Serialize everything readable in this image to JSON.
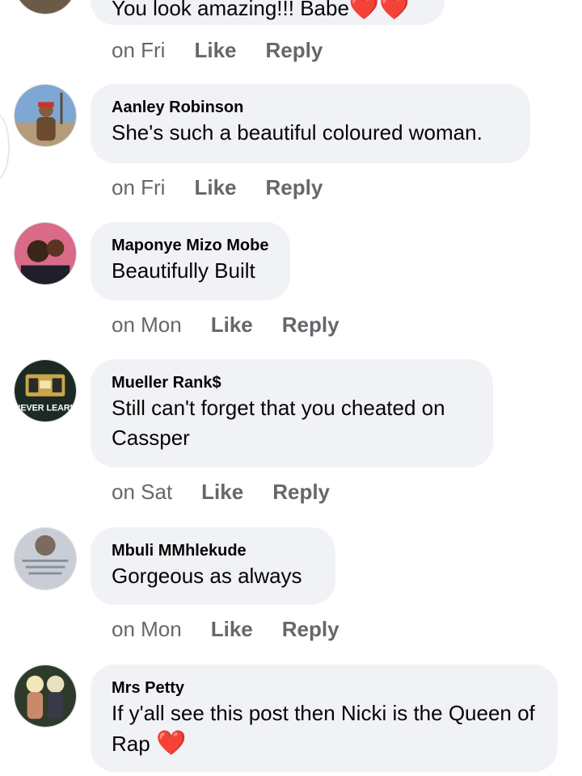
{
  "top": {
    "text": "You look amazing!!! Babe",
    "hearts": "❤️❤️",
    "time": "on Fri",
    "like": "Like",
    "reply": "Reply"
  },
  "comments": [
    {
      "name": "Aanley Robinson",
      "text": "She's such a beautiful coloured woman.",
      "time": "on Fri",
      "like": "Like",
      "reply": "Reply"
    },
    {
      "name": "Maponye Mizo Mobe",
      "text": "Beautifully Built",
      "time": "on Mon",
      "like": "Like",
      "reply": "Reply"
    },
    {
      "name": "Mueller Rank$",
      "text": "Still can't forget that you cheated on Cassper",
      "time": "on Sat",
      "like": "Like",
      "reply": "Reply",
      "avatar_text": "NEVER LEARN"
    },
    {
      "name": "Mbuli MMhlekude",
      "text": "Gorgeous as always",
      "time": "on Mon",
      "like": "Like",
      "reply": "Reply"
    },
    {
      "name": "Mrs Petty",
      "text": "If y'all see this post then Nicki is the Queen of Rap",
      "heart": "❤️"
    }
  ],
  "colors": {
    "bubble": "#f0f2f5",
    "meta": "#65676b",
    "text": "#050505"
  }
}
